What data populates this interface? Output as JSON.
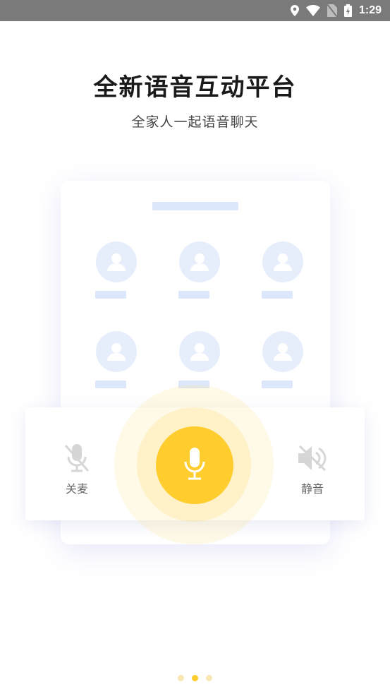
{
  "status_bar": {
    "time": "1:29",
    "icons": [
      "location-icon",
      "wifi-icon",
      "no-sim-icon",
      "battery-charging-icon"
    ]
  },
  "intro": {
    "title": "全新语音互动平台",
    "subtitle": "全家人一起语音聊天"
  },
  "illustration": {
    "seats": [
      "avatar-placeholder",
      "avatar-placeholder",
      "avatar-placeholder",
      "avatar-placeholder",
      "avatar-placeholder",
      "avatar-placeholder"
    ]
  },
  "controls": {
    "mute_mic_label": "关麦",
    "mute_speaker_label": "静音",
    "mute_mic_icon": "mic-off-icon",
    "mute_speaker_icon": "speaker-mute-icon",
    "talk_icon": "microphone-icon"
  },
  "pager": {
    "total": 3,
    "current": 2
  },
  "colors": {
    "accent": "#ffcd2e",
    "placeholder": "#dde7fb",
    "status_bar": "#7a7a7a"
  }
}
